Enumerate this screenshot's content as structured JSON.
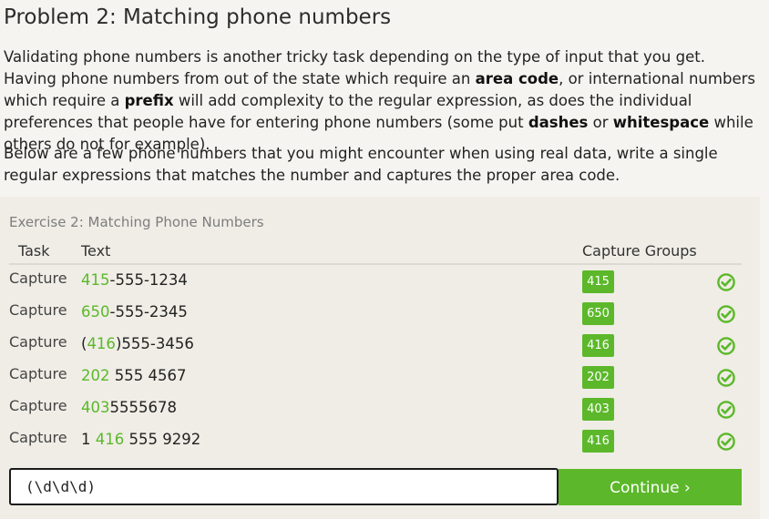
{
  "title": "Problem 2: Matching phone numbers",
  "intro": {
    "s1": "Validating phone numbers is another tricky task depending on the type of input that you get. Having phone numbers from out of the state which require an ",
    "b1": "area code",
    "s2": ", or international numbers which require a ",
    "b2": "prefix",
    "s3": " will add complexity to the regular expression, as does the individual preferences that people have for entering phone numbers (some put ",
    "b3": "dashes",
    "s4": " or ",
    "b4": "whitespace",
    "s5": " while others do not for example)."
  },
  "instructions": "Below are a few phone numbers that you might encounter when using real data, write a single regular expressions that matches the number and captures the proper area code.",
  "exercise": {
    "title": "Exercise 2: Matching Phone Numbers",
    "headers": {
      "task": "Task",
      "text": "Text",
      "groups": "Capture Groups"
    },
    "rows": [
      {
        "task": "Capture",
        "pre": "",
        "match": "415",
        "post": "-555-1234",
        "group": "415",
        "passed": true
      },
      {
        "task": "Capture",
        "pre": "",
        "match": "650",
        "post": "-555-2345",
        "group": "650",
        "passed": true
      },
      {
        "task": "Capture",
        "pre": "(",
        "match": "416",
        "post": ")555-3456",
        "group": "416",
        "passed": true
      },
      {
        "task": "Capture",
        "pre": "",
        "match": "202",
        "post": " 555 4567",
        "group": "202",
        "passed": true
      },
      {
        "task": "Capture",
        "pre": "",
        "match": "403",
        "post": "5555678",
        "group": "403",
        "passed": true
      },
      {
        "task": "Capture",
        "pre": "1 ",
        "match": "416",
        "post": " 555 9292",
        "group": "416",
        "passed": true
      }
    ],
    "input_value": "(\\d\\d\\d)",
    "continue_label": "Continue ›"
  },
  "colors": {
    "accent": "#5cb82a",
    "background": "#f5f4f0",
    "panel": "#efede6"
  },
  "icons": {
    "row_status": "check-circle-icon"
  }
}
